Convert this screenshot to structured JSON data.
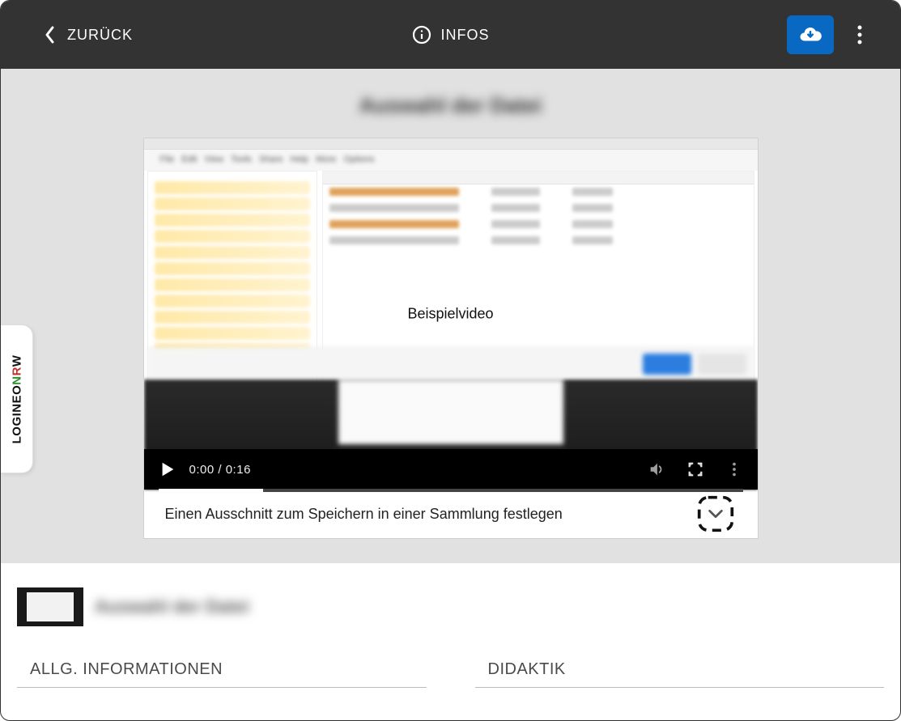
{
  "topbar": {
    "back_label": "ZURÜCK",
    "info_label": "INFOS"
  },
  "page_title_blurred": "Auswahl der Datei",
  "video": {
    "overlay_label": "Beispielvideo",
    "time_current": "0:00",
    "time_total": "0:16",
    "clip_bar_text": "Einen Ausschnitt zum Speichern in einer Sammlung festlegen"
  },
  "lower": {
    "title_blurred": "Auswahl der Datei"
  },
  "sections": {
    "info_header": "ALLG. INFORMATIONEN",
    "didactics_header": "DIDAKTIK"
  },
  "side_tab": {
    "part1": "LOGINEO",
    "part2": "N",
    "part3": "R",
    "part4": "W"
  }
}
